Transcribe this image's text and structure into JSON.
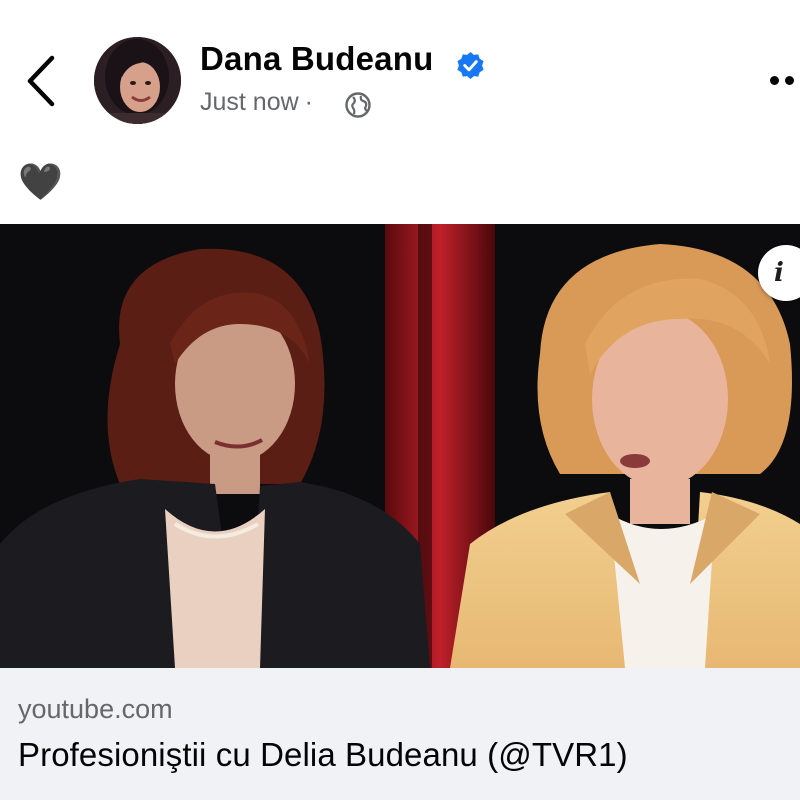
{
  "post": {
    "author": {
      "name": "Dana Budeanu",
      "verified": true,
      "avatar": "profile-photo"
    },
    "timestamp": "Just now",
    "separator": "·",
    "audience_icon": "globe-icon",
    "text": "🖤"
  },
  "navigation": {
    "back_icon": "chevron-left-icon",
    "more_icon": "more-dots-icon"
  },
  "link_preview": {
    "domain": "youtube.com",
    "title": "Profesioniştii cu Delia Budeanu (@TVR1)",
    "info_icon": "info-icon",
    "info_glyph": "i"
  },
  "colors": {
    "name_text": "#050505",
    "meta_text": "#65676b",
    "verified_badge": "#1877f2",
    "link_background": "#f0f2f5"
  }
}
